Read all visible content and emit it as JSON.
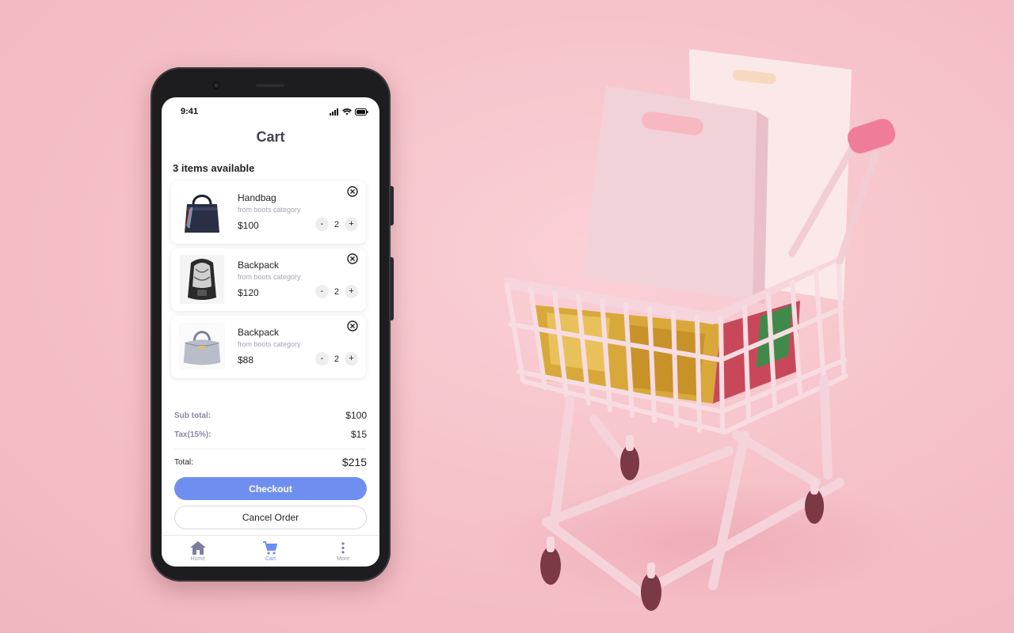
{
  "status_bar": {
    "time": "9:41"
  },
  "header": {
    "title": "Cart"
  },
  "cart": {
    "count_text": "3 items available",
    "items": [
      {
        "name": "Handbag",
        "category": "from boots category",
        "price": "$100",
        "qty": "2",
        "minus": "-",
        "plus": "+",
        "image_icon": "handbag-icon"
      },
      {
        "name": "Backpack",
        "category": "from boots category",
        "price": "$120",
        "qty": "2",
        "minus": "-",
        "plus": "+",
        "image_icon": "backpack-icon"
      },
      {
        "name": "Backpack",
        "category": "from boots category",
        "price": "$88",
        "qty": "2",
        "minus": "-",
        "plus": "+",
        "image_icon": "purse-icon"
      }
    ]
  },
  "summary": {
    "subtotal_label": "Sub total:",
    "subtotal_value": "$100",
    "tax_label": "Tax(15%):",
    "tax_value": "$15",
    "total_label": "Total:",
    "total_value": "$215"
  },
  "actions": {
    "checkout": "Checkout",
    "cancel": "Cancel Order"
  },
  "tabbar": [
    {
      "label": "Home",
      "icon": "home-icon",
      "active": false
    },
    {
      "label": "Cart",
      "icon": "cart-icon",
      "active": true
    },
    {
      "label": "More",
      "icon": "more-vertical-icon",
      "active": false
    }
  ],
  "colors": {
    "background": "#f7c3cb",
    "accent": "#6f8ff0",
    "phone_frame": "#1d1d1f"
  }
}
